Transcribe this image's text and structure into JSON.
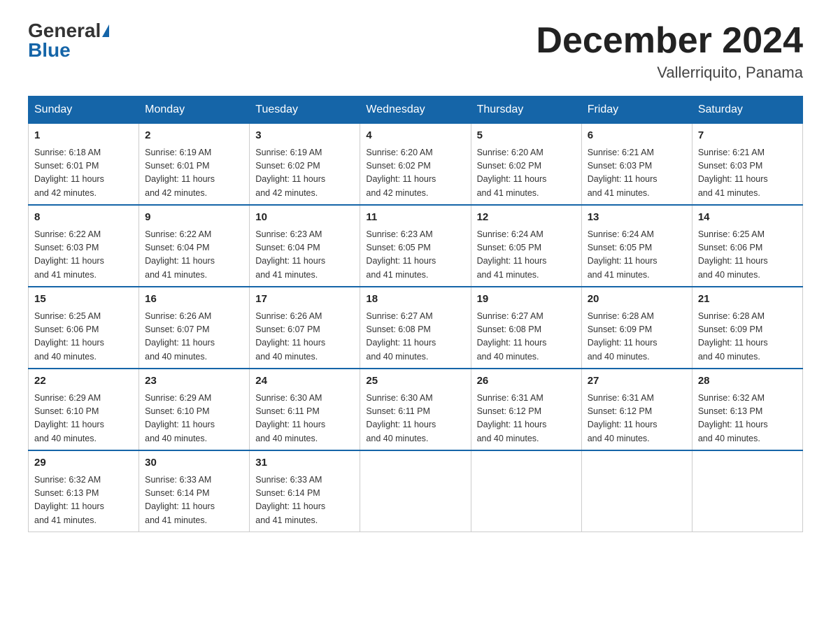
{
  "logo": {
    "general": "General",
    "blue": "Blue"
  },
  "header": {
    "month_year": "December 2024",
    "location": "Vallerriquito, Panama"
  },
  "days_of_week": [
    "Sunday",
    "Monday",
    "Tuesday",
    "Wednesday",
    "Thursday",
    "Friday",
    "Saturday"
  ],
  "weeks": [
    [
      {
        "day": "1",
        "sunrise": "6:18 AM",
        "sunset": "6:01 PM",
        "daylight": "11 hours and 42 minutes."
      },
      {
        "day": "2",
        "sunrise": "6:19 AM",
        "sunset": "6:01 PM",
        "daylight": "11 hours and 42 minutes."
      },
      {
        "day": "3",
        "sunrise": "6:19 AM",
        "sunset": "6:02 PM",
        "daylight": "11 hours and 42 minutes."
      },
      {
        "day": "4",
        "sunrise": "6:20 AM",
        "sunset": "6:02 PM",
        "daylight": "11 hours and 42 minutes."
      },
      {
        "day": "5",
        "sunrise": "6:20 AM",
        "sunset": "6:02 PM",
        "daylight": "11 hours and 41 minutes."
      },
      {
        "day": "6",
        "sunrise": "6:21 AM",
        "sunset": "6:03 PM",
        "daylight": "11 hours and 41 minutes."
      },
      {
        "day": "7",
        "sunrise": "6:21 AM",
        "sunset": "6:03 PM",
        "daylight": "11 hours and 41 minutes."
      }
    ],
    [
      {
        "day": "8",
        "sunrise": "6:22 AM",
        "sunset": "6:03 PM",
        "daylight": "11 hours and 41 minutes."
      },
      {
        "day": "9",
        "sunrise": "6:22 AM",
        "sunset": "6:04 PM",
        "daylight": "11 hours and 41 minutes."
      },
      {
        "day": "10",
        "sunrise": "6:23 AM",
        "sunset": "6:04 PM",
        "daylight": "11 hours and 41 minutes."
      },
      {
        "day": "11",
        "sunrise": "6:23 AM",
        "sunset": "6:05 PM",
        "daylight": "11 hours and 41 minutes."
      },
      {
        "day": "12",
        "sunrise": "6:24 AM",
        "sunset": "6:05 PM",
        "daylight": "11 hours and 41 minutes."
      },
      {
        "day": "13",
        "sunrise": "6:24 AM",
        "sunset": "6:05 PM",
        "daylight": "11 hours and 41 minutes."
      },
      {
        "day": "14",
        "sunrise": "6:25 AM",
        "sunset": "6:06 PM",
        "daylight": "11 hours and 40 minutes."
      }
    ],
    [
      {
        "day": "15",
        "sunrise": "6:25 AM",
        "sunset": "6:06 PM",
        "daylight": "11 hours and 40 minutes."
      },
      {
        "day": "16",
        "sunrise": "6:26 AM",
        "sunset": "6:07 PM",
        "daylight": "11 hours and 40 minutes."
      },
      {
        "day": "17",
        "sunrise": "6:26 AM",
        "sunset": "6:07 PM",
        "daylight": "11 hours and 40 minutes."
      },
      {
        "day": "18",
        "sunrise": "6:27 AM",
        "sunset": "6:08 PM",
        "daylight": "11 hours and 40 minutes."
      },
      {
        "day": "19",
        "sunrise": "6:27 AM",
        "sunset": "6:08 PM",
        "daylight": "11 hours and 40 minutes."
      },
      {
        "day": "20",
        "sunrise": "6:28 AM",
        "sunset": "6:09 PM",
        "daylight": "11 hours and 40 minutes."
      },
      {
        "day": "21",
        "sunrise": "6:28 AM",
        "sunset": "6:09 PM",
        "daylight": "11 hours and 40 minutes."
      }
    ],
    [
      {
        "day": "22",
        "sunrise": "6:29 AM",
        "sunset": "6:10 PM",
        "daylight": "11 hours and 40 minutes."
      },
      {
        "day": "23",
        "sunrise": "6:29 AM",
        "sunset": "6:10 PM",
        "daylight": "11 hours and 40 minutes."
      },
      {
        "day": "24",
        "sunrise": "6:30 AM",
        "sunset": "6:11 PM",
        "daylight": "11 hours and 40 minutes."
      },
      {
        "day": "25",
        "sunrise": "6:30 AM",
        "sunset": "6:11 PM",
        "daylight": "11 hours and 40 minutes."
      },
      {
        "day": "26",
        "sunrise": "6:31 AM",
        "sunset": "6:12 PM",
        "daylight": "11 hours and 40 minutes."
      },
      {
        "day": "27",
        "sunrise": "6:31 AM",
        "sunset": "6:12 PM",
        "daylight": "11 hours and 40 minutes."
      },
      {
        "day": "28",
        "sunrise": "6:32 AM",
        "sunset": "6:13 PM",
        "daylight": "11 hours and 40 minutes."
      }
    ],
    [
      {
        "day": "29",
        "sunrise": "6:32 AM",
        "sunset": "6:13 PM",
        "daylight": "11 hours and 41 minutes."
      },
      {
        "day": "30",
        "sunrise": "6:33 AM",
        "sunset": "6:14 PM",
        "daylight": "11 hours and 41 minutes."
      },
      {
        "day": "31",
        "sunrise": "6:33 AM",
        "sunset": "6:14 PM",
        "daylight": "11 hours and 41 minutes."
      },
      null,
      null,
      null,
      null
    ]
  ],
  "labels": {
    "sunrise": "Sunrise:",
    "sunset": "Sunset:",
    "daylight": "Daylight:"
  }
}
